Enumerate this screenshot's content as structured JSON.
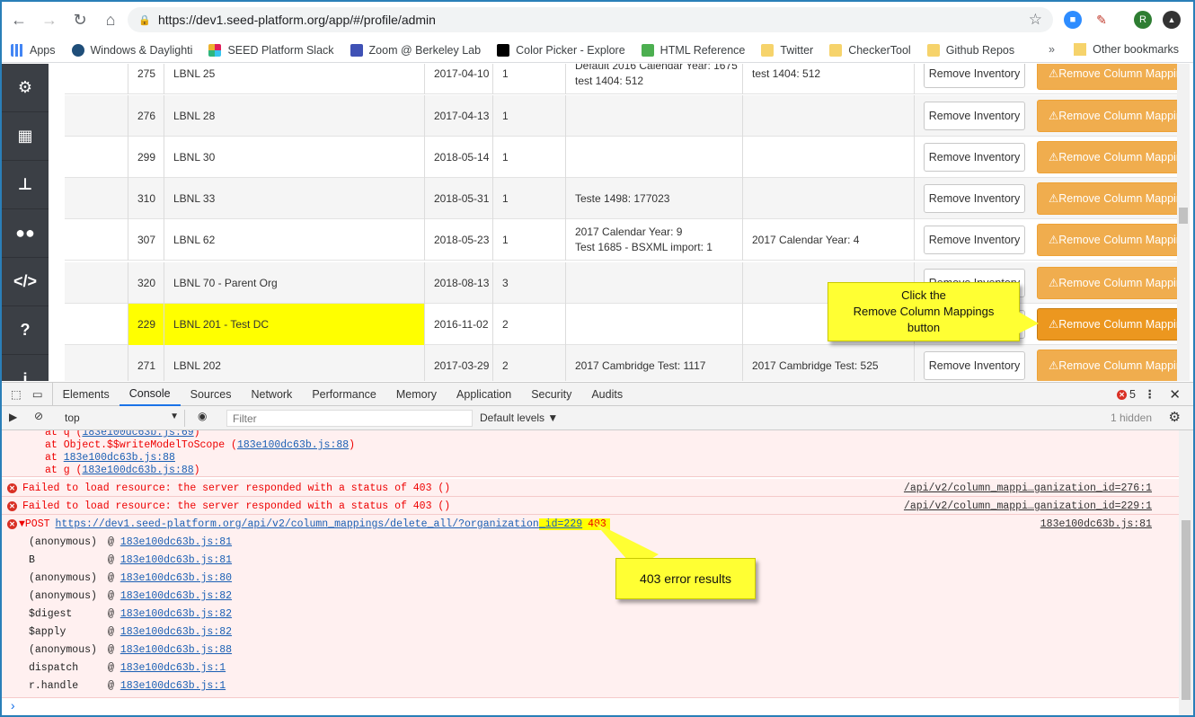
{
  "browser": {
    "url": "https://dev1.seed-platform.org/app/#/profile/admin",
    "profile_initial": "R"
  },
  "bookmarks": {
    "items": [
      "Apps",
      "Windows & Daylighti",
      "SEED Platform Slack",
      "Zoom @ Berkeley Lab",
      "Color Picker - Explore",
      "HTML Reference",
      "Twitter",
      "CheckerTool",
      "Github Repos"
    ],
    "more": "»",
    "other": "Other bookmarks"
  },
  "table": {
    "rows": [
      {
        "id": "275",
        "name": "LBNL 25",
        "date": "2017-04-10",
        "count": "1",
        "m1": [
          "Default 2016 Calendar Year: 1675",
          "test 1404: 512"
        ],
        "m2": "test 1404: 512"
      },
      {
        "id": "276",
        "name": "LBNL 28",
        "date": "2017-04-13",
        "count": "1",
        "m1": [],
        "m2": ""
      },
      {
        "id": "299",
        "name": "LBNL 30",
        "date": "2018-05-14",
        "count": "1",
        "m1": [],
        "m2": ""
      },
      {
        "id": "310",
        "name": "LBNL 33",
        "date": "2018-05-31",
        "count": "1",
        "m1": [
          "Teste 1498: 177023"
        ],
        "m2": ""
      },
      {
        "id": "307",
        "name": "LBNL 62",
        "date": "2018-05-23",
        "count": "1",
        "m1": [
          "2017 Calendar Year: 9",
          "Test 1685 - BSXML import: 1"
        ],
        "m2": "2017 Calendar Year: 4"
      },
      {
        "id": "320",
        "name": "LBNL 70 - Parent Org",
        "date": "2018-08-13",
        "count": "3",
        "m1": [],
        "m2": ""
      },
      {
        "id": "229",
        "name": "LBNL 201 - Test DC",
        "date": "2016-11-02",
        "count": "2",
        "m1": [],
        "m2": ""
      },
      {
        "id": "271",
        "name": "LBNL 202",
        "date": "2017-03-29",
        "count": "2",
        "m1": [
          "2017 Cambridge Test: 1117"
        ],
        "m2": "2017 Cambridge Test: 525"
      }
    ],
    "remove_inventory_label": "Remove Inventory",
    "remove_mappings_label": "Remove Column Mappings"
  },
  "callouts": {
    "click": [
      "Click the",
      "Remove Column Mappings",
      "button"
    ],
    "error": "403 error results"
  },
  "devtools": {
    "tabs": [
      "Elements",
      "Console",
      "Sources",
      "Network",
      "Performance",
      "Memory",
      "Application",
      "Security",
      "Audits"
    ],
    "active_tab": "Console",
    "error_count": "5",
    "context": "top",
    "filter_placeholder": "Filter",
    "levels": "Default levels ▼",
    "hidden": "1 hidden",
    "top_stack": [
      {
        "prefix": "at q (",
        "link": "183e100dc63b.js:69",
        "suffix": ")"
      },
      {
        "prefix": "at Object.$$writeModelToScope (",
        "link": "183e100dc63b.js:88",
        "suffix": ")"
      },
      {
        "prefix": "at ",
        "link": "183e100dc63b.js:88",
        "suffix": ""
      },
      {
        "prefix": "at g (",
        "link": "183e100dc63b.js:88",
        "suffix": ")"
      }
    ],
    "errors": [
      {
        "text": "Failed to load resource: the server responded with a status of 403 ()",
        "src": "/api/v2/column_mappi…ganization_id=276:1"
      },
      {
        "text": "Failed to load resource: the server responded with a status of 403 ()",
        "src": "/api/v2/column_mappi…ganization_id=229:1"
      }
    ],
    "post": {
      "method": "▼POST",
      "url_a": "https://dev1.seed-platform.org/api/v2/column_mappings/delete_all/?organization",
      "url_b": "_id=229",
      "status": "403",
      "src": "183e100dc63b.js:81"
    },
    "stack": [
      {
        "fn": "(anonymous)",
        "src": "183e100dc63b.js:81"
      },
      {
        "fn": "B",
        "src": "183e100dc63b.js:81"
      },
      {
        "fn": "(anonymous)",
        "src": "183e100dc63b.js:80"
      },
      {
        "fn": "(anonymous)",
        "src": "183e100dc63b.js:82"
      },
      {
        "fn": "$digest",
        "src": "183e100dc63b.js:82"
      },
      {
        "fn": "$apply",
        "src": "183e100dc63b.js:82"
      },
      {
        "fn": "(anonymous)",
        "src": "183e100dc63b.js:88"
      },
      {
        "fn": "dispatch",
        "src": "183e100dc63b.js:1"
      },
      {
        "fn": "r.handle",
        "src": "183e100dc63b.js:1"
      }
    ],
    "prompt": "›"
  }
}
